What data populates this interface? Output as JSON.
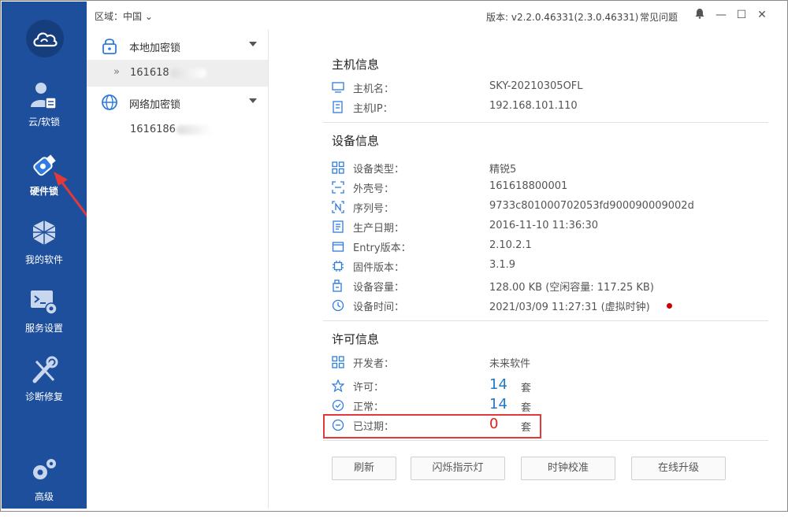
{
  "topbar": {
    "region_label": "区域：中国",
    "version": "版本: v2.2.0.46331(2.3.0.46331)",
    "faq": "常见问题"
  },
  "nav": {
    "items": [
      {
        "label": "云/软锁",
        "icon": "user-card-icon"
      },
      {
        "label": "硬件锁",
        "icon": "usb-key-icon"
      },
      {
        "label": "我的软件",
        "icon": "cubes-icon"
      },
      {
        "label": "服务设置",
        "icon": "terminal-gear-icon"
      },
      {
        "label": "诊断修复",
        "icon": "wrench-screwdriver-icon"
      },
      {
        "label": "高级",
        "icon": "gears-icon"
      }
    ],
    "active_index": 1
  },
  "tree": {
    "local": {
      "label": "本地加密锁",
      "child": "161618"
    },
    "network": {
      "label": "网络加密锁",
      "child": "1616186"
    }
  },
  "host": {
    "title": "主机信息",
    "rows": [
      {
        "key": "主机名：",
        "value": "SKY-20210305OFL",
        "icon": "monitor-icon"
      },
      {
        "key": "主机IP：",
        "value": "192.168.101.110",
        "icon": "server-icon"
      }
    ]
  },
  "device": {
    "title": "设备信息",
    "rows": [
      {
        "key": "设备类型：",
        "value": "精锐5",
        "icon": "grid-icon"
      },
      {
        "key": "外壳号：",
        "value": "161618800001",
        "icon": "scan-frame-icon"
      },
      {
        "key": "序列号：",
        "value": "9733c801000702053fd900090009002d",
        "icon": "serial-n-icon"
      },
      {
        "key": "生产日期：",
        "value": "2016-11-10 11:36:30",
        "icon": "document-icon"
      },
      {
        "key": "Entry版本：",
        "value": "2.10.2.1",
        "icon": "box-icon"
      },
      {
        "key": "固件版本：",
        "value": "3.1.9",
        "icon": "chip-icon"
      },
      {
        "key": "设备容量：",
        "value": "128.00 KB (空闲容量: 117.25 KB)",
        "icon": "storage-icon"
      },
      {
        "key": "设备时间：",
        "value": "2021/03/09 11:27:31 (虚拟时钟)",
        "icon": "clock-icon"
      }
    ]
  },
  "license": {
    "title": "许可信息",
    "developer_key": "开发者：",
    "developer_value": "未来软件",
    "rows": [
      {
        "key": "许可：",
        "count": "14",
        "unit": "套",
        "icon": "star-icon"
      },
      {
        "key": "正常：",
        "count": "14",
        "unit": "套",
        "icon": "check-circle-icon"
      },
      {
        "key": "已过期：",
        "count": "0",
        "unit": "套",
        "icon": "minus-circle-icon"
      }
    ]
  },
  "buttons": {
    "refresh": "刷新",
    "flash": "闪烁指示灯",
    "clock": "时钟校准",
    "upgrade": "在线升级"
  },
  "colors": {
    "nav_bg": "#1e4f9c",
    "accent": "#1f78c8",
    "expired": "#e02020",
    "highlight_box": "#e23a3a"
  }
}
